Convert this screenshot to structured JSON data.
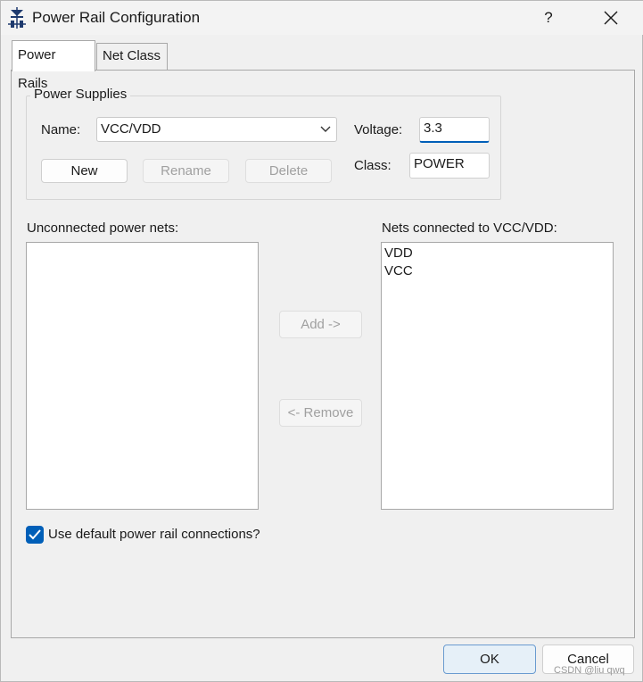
{
  "window": {
    "title": "Power Rail Configuration",
    "help_label": "?",
    "close_label": "✕"
  },
  "tabs": [
    {
      "label": "Power Rails",
      "active": true
    },
    {
      "label": "Net Class",
      "active": false
    }
  ],
  "power_supplies": {
    "legend": "Power Supplies",
    "name_label": "Name:",
    "name_value": "VCC/VDD",
    "voltage_label": "Voltage:",
    "voltage_value": "3.3",
    "class_label": "Class:",
    "class_value": "POWER",
    "new_label": "New",
    "rename_label": "Rename",
    "delete_label": "Delete"
  },
  "unconnected": {
    "label": "Unconnected power nets:",
    "items": []
  },
  "connected": {
    "label": "Nets connected to VCC/VDD:",
    "items": [
      "VDD",
      "VCC"
    ]
  },
  "transfer": {
    "add_label": "Add ->",
    "remove_label": "<- Remove"
  },
  "use_default": {
    "label": "Use default power rail connections?",
    "checked": true
  },
  "footer": {
    "ok_label": "OK",
    "cancel_label": "Cancel"
  },
  "watermark": "CSDN @liu qwq",
  "colors": {
    "accent": "#005fb8",
    "window_bg": "#f0f0f0"
  },
  "icons": {
    "app": "diode-icon",
    "dropdown": "chevron-down-icon",
    "check": "check-icon"
  }
}
